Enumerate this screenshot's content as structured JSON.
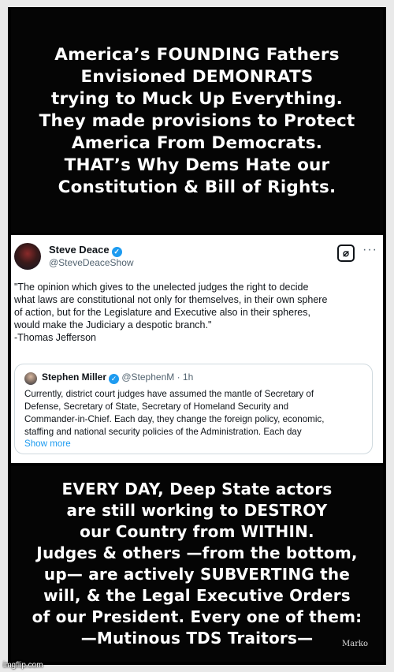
{
  "top_panel": {
    "text": "America’s FOUNDING Fathers\nEnvisioned DEMONRATS\ntrying to Muck Up Everything.\nThey made provisions to Protect\nAmerica From Democrats.\nTHAT’s Why Dems Hate our\nConstitution & Bill of Rights."
  },
  "tweet": {
    "author_name": "Steve Deace",
    "author_handle": "@SteveDeaceShow",
    "verified_icon": "✓",
    "grok_icon": "⌀",
    "more_icon": "···",
    "body": "\"The opinion which gives to the unelected judges the right to decide\nwhat laws are constitutional not only for themselves, in their own sphere\nof action, but for the Legislature and Executive also in their spheres,\nwould make the Judiciary a despotic branch.\"\n-Thomas Jefferson",
    "quote": {
      "author_name": "Stephen Miller",
      "author_handle_time": "@StephenM · 1h",
      "body": "Currently, district court judges have assumed the mantle of Secretary of\nDefense, Secretary of State, Secretary of Homeland Security and\nCommander-in-Chief. Each day, they change the foreign policy, economic,\nstaffing and national security policies of the Administration. Each day",
      "show_more": "Show more"
    }
  },
  "bottom_panel": {
    "text": "EVERY DAY, Deep State actors\nare still working to DESTROY\nour Country from WITHIN.\nJudges & others —from the bottom,\nup— are actively SUBVERTING the\nwill, & the Legal Executive Orders\nof our President.  Every one of them:\n—Mutinous TDS Traitors—",
    "signature": "Marko"
  },
  "watermark": "imgflip.com",
  "colors": {
    "panel_background": "#050505",
    "link_blue": "#1d9bf0",
    "verified_blue": "#1d9bf0"
  }
}
